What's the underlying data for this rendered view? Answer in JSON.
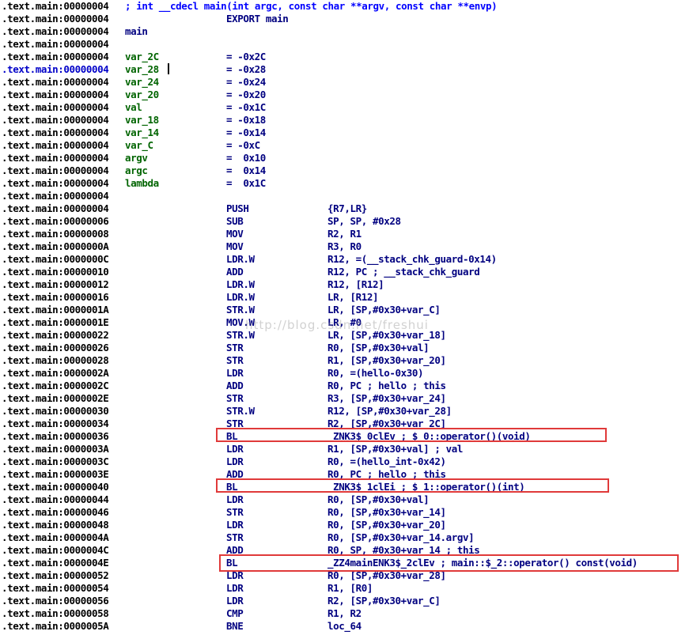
{
  "listing": {
    "segment_prefix": ".text.main:",
    "rows": [
      {
        "addr": "00000004",
        "comment": "; int __cdecl main(int argc, const char **argv, const char **envp)"
      },
      {
        "addr": "00000004",
        "op": "EXPORT main"
      },
      {
        "addr": "00000004",
        "label": "main"
      },
      {
        "addr": "00000004"
      },
      {
        "addr": "00000004",
        "label": "var_2C",
        "op": "= -0x2C"
      },
      {
        "addr": "00000004",
        "label": "var_28",
        "op": "= -0x28",
        "current": true
      },
      {
        "addr": "00000004",
        "label": "var_24",
        "op": "= -0x24"
      },
      {
        "addr": "00000004",
        "label": "var_20",
        "op": "= -0x20"
      },
      {
        "addr": "00000004",
        "label": "val",
        "op": "= -0x1C"
      },
      {
        "addr": "00000004",
        "label": "var_18",
        "op": "= -0x18"
      },
      {
        "addr": "00000004",
        "label": "var_14",
        "op": "= -0x14"
      },
      {
        "addr": "00000004",
        "label": "var_C",
        "op": "= -0xC"
      },
      {
        "addr": "00000004",
        "label": "argv",
        "op": "=  0x10"
      },
      {
        "addr": "00000004",
        "label": "argc",
        "op": "=  0x14"
      },
      {
        "addr": "00000004",
        "label": "lambda",
        "op": "=  0x1C"
      },
      {
        "addr": "00000004"
      },
      {
        "addr": "00000004",
        "op": "PUSH",
        "args": "{R7,LR}"
      },
      {
        "addr": "00000006",
        "op": "SUB",
        "args": "SP, SP, #0x28"
      },
      {
        "addr": "00000008",
        "op": "MOV",
        "args": "R2, R1"
      },
      {
        "addr": "0000000A",
        "op": "MOV",
        "args": "R3, R0"
      },
      {
        "addr": "0000000C",
        "op": "LDR.W",
        "args": "R12, =(__stack_chk_guard-0x14)"
      },
      {
        "addr": "00000010",
        "op": "ADD",
        "args": "R12, PC ; __stack_chk_guard"
      },
      {
        "addr": "00000012",
        "op": "LDR.W",
        "args": "R12, [R12]"
      },
      {
        "addr": "00000016",
        "op": "LDR.W",
        "args": "LR, [R12]"
      },
      {
        "addr": "0000001A",
        "op": "STR.W",
        "args": "LR, [SP,#0x30+var_C]"
      },
      {
        "addr": "0000001E",
        "op": "MOV.W",
        "args": "LR, #0"
      },
      {
        "addr": "00000022",
        "op": "STR.W",
        "args": "LR, [SP,#0x30+var_18]"
      },
      {
        "addr": "00000026",
        "op": "STR",
        "args": "R0, [SP,#0x30+val]"
      },
      {
        "addr": "00000028",
        "op": "STR",
        "args": "R1, [SP,#0x30+var_20]"
      },
      {
        "addr": "0000002A",
        "op": "LDR",
        "args": "R0, =(hello-0x30)"
      },
      {
        "addr": "0000002C",
        "op": "ADD",
        "args": "R0, PC ; hello ; this"
      },
      {
        "addr": "0000002E",
        "op": "STR",
        "args": "R3, [SP,#0x30+var_24]"
      },
      {
        "addr": "00000030",
        "op": "STR.W",
        "args": "R12, [SP,#0x30+var_28]"
      },
      {
        "addr": "00000034",
        "op": "STR",
        "args": "R2, [SP,#0x30+var_2C]"
      },
      {
        "addr": "00000036",
        "op": "BL",
        "args": " ZNK3$_0clEv ; $_0::operator()(void)"
      },
      {
        "addr": "0000003A",
        "op": "LDR",
        "args": "R1, [SP,#0x30+val] ; val"
      },
      {
        "addr": "0000003C",
        "op": "LDR",
        "args": "R0, =(hello_int-0x42)"
      },
      {
        "addr": "0000003E",
        "op": "ADD",
        "args": "R0, PC ; hello ; this"
      },
      {
        "addr": "00000040",
        "op": "BL",
        "args": " ZNK3$_1clEi ; $_1::operator()(int)"
      },
      {
        "addr": "00000044",
        "op": "LDR",
        "args": "R0, [SP,#0x30+val]"
      },
      {
        "addr": "00000046",
        "op": "STR",
        "args": "R0, [SP,#0x30+var_14]"
      },
      {
        "addr": "00000048",
        "op": "LDR",
        "args": "R0, [SP,#0x30+var_20]"
      },
      {
        "addr": "0000004A",
        "op": "STR",
        "args": "R0, [SP,#0x30+var_14.argv]"
      },
      {
        "addr": "0000004C",
        "op": "ADD",
        "args": "R0, SP, #0x30+var_14 ; this"
      },
      {
        "addr": "0000004E",
        "op": "BL",
        "args": "_ZZ4mainENK3$_2clEv ; main::$_2::operator() const(void)"
      },
      {
        "addr": "00000052",
        "op": "LDR",
        "args": "R0, [SP,#0x30+var_28]"
      },
      {
        "addr": "00000054",
        "op": "LDR",
        "args": "R1, [R0]"
      },
      {
        "addr": "00000056",
        "op": "LDR",
        "args": "R2, [SP,#0x30+var_C]"
      },
      {
        "addr": "00000058",
        "op": "CMP",
        "args": "R1, R2"
      },
      {
        "addr": "0000005A",
        "op": "BNE",
        "args": "loc_64"
      }
    ]
  },
  "watermark": "http://blog.csdn.net/freshui",
  "colors": {
    "highlight_box": "#e03a3a",
    "comment": "#0000ff",
    "mnemonic": "#000080",
    "label": "#006400",
    "import_symbol": "#e000e0",
    "auto_comment": "#7f7f7f"
  }
}
